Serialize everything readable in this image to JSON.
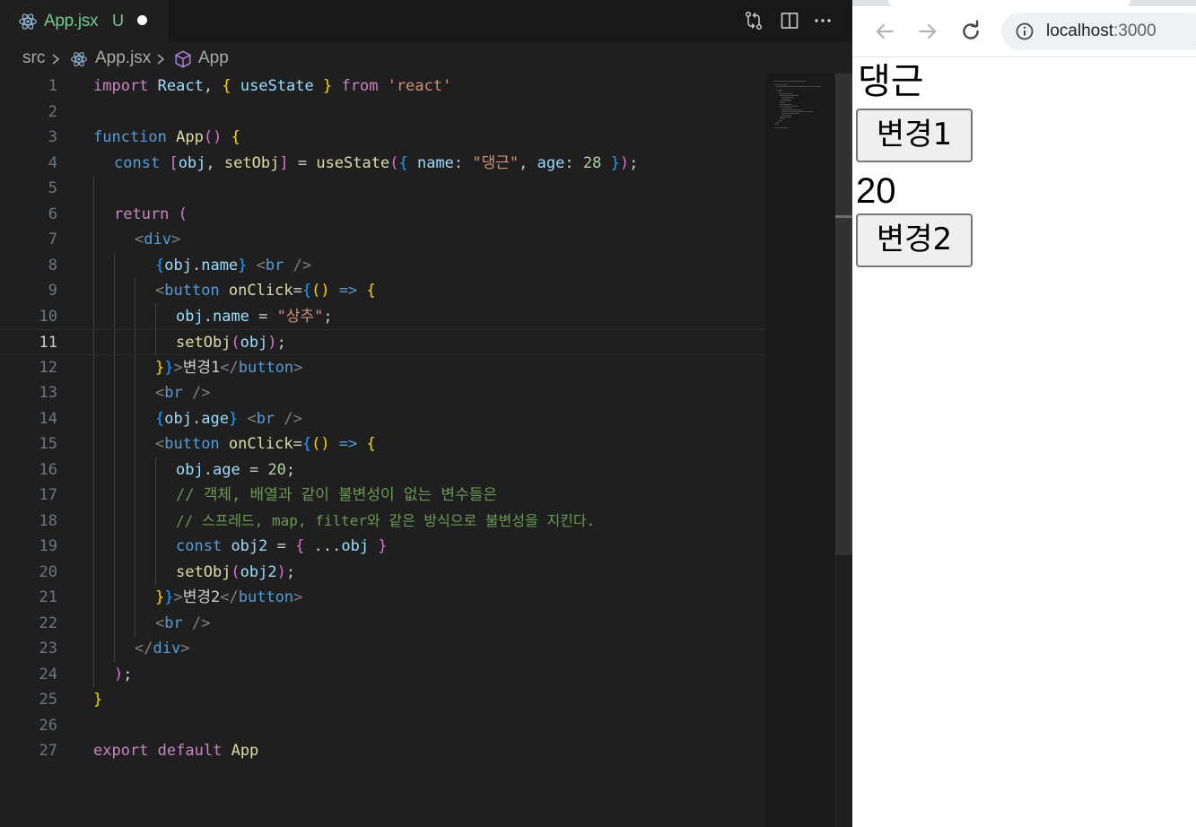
{
  "editor": {
    "tab": {
      "filename": "App.jsx",
      "status": "U"
    },
    "toolbar": {
      "icons": [
        "source-control-compare-icon",
        "split-editor-icon",
        "more-actions-icon"
      ]
    },
    "breadcrumb": {
      "folder": "src",
      "file": "App.jsx",
      "symbol": "App"
    },
    "active_line": 11,
    "line_numbers": [
      "1",
      "2",
      "3",
      "4",
      "5",
      "6",
      "7",
      "8",
      "9",
      "10",
      "11",
      "12",
      "13",
      "14",
      "15",
      "16",
      "17",
      "18",
      "19",
      "20",
      "21",
      "22",
      "23",
      "24",
      "25",
      "26",
      "27"
    ],
    "code": {
      "l1": {
        "import": "import",
        "react": "React",
        "comma": ",",
        "lb": "{",
        "useState": "useState",
        "rb": "}",
        "from": "from",
        "mod": "'react'"
      },
      "l3": {
        "function": "function",
        "name": "App",
        "parens": "()",
        "lb": "{"
      },
      "l4": {
        "const": "const",
        "lb": "[",
        "obj": "obj",
        "comma": ",",
        "setObj": "setObj",
        "rb": "]",
        "eq": "=",
        "useState": "useState",
        "lp": "(",
        "lc": "{",
        "key1": "name",
        "colon1": ":",
        "val1": "\"댕근\"",
        "comma2": ",",
        "key2": "age",
        "colon2": ":",
        "val2": "28",
        "rc": "}",
        "rp": ")",
        "semi": ";"
      },
      "l6": {
        "return": "return",
        "lp": "("
      },
      "l7": {
        "open": "<",
        "tag": "div",
        "close": ">"
      },
      "l8": {
        "lb": "{",
        "obj": "obj",
        "dot": ".",
        "prop": "name",
        "rb": "}",
        "open": "<",
        "tag": "br",
        "close": "/>"
      },
      "l9": {
        "open": "<",
        "tag": "button",
        "attr": "onClick",
        "eq": "=",
        "lb": "{",
        "parens": "()",
        "arrow": "=>",
        "lc": "{"
      },
      "l10": {
        "obj": "obj",
        "dot": ".",
        "prop": "name",
        "eq": "=",
        "val": "\"상추\"",
        "semi": ";"
      },
      "l11": {
        "fn": "setObj",
        "lp": "(",
        "arg": "obj",
        "rp": ")",
        "semi": ";"
      },
      "l12": {
        "rc": "}",
        "rb": "}",
        "gt": ">",
        "text": "변경1",
        "open": "</",
        "tag": "button",
        "close": ">"
      },
      "l13": {
        "open": "<",
        "tag": "br",
        "close": "/>"
      },
      "l14": {
        "lb": "{",
        "obj": "obj",
        "dot": ".",
        "prop": "age",
        "rb": "}",
        "open": "<",
        "tag": "br",
        "close": "/>"
      },
      "l15": {
        "open": "<",
        "tag": "button",
        "attr": "onClick",
        "eq": "=",
        "lb": "{",
        "parens": "()",
        "arrow": "=>",
        "lc": "{"
      },
      "l16": {
        "obj": "obj",
        "dot": ".",
        "prop": "age",
        "eq": "=",
        "val": "20",
        "semi": ";"
      },
      "l17": {
        "comment": "// 객체, 배열과 같이 불변성이 없는 변수들은"
      },
      "l18": {
        "comment": "// 스프레드, map, filter와 같은 방식으로 불변성을 지킨다."
      },
      "l19": {
        "const": "const",
        "name": "obj2",
        "eq": "=",
        "lb": "{",
        "spread": "...",
        "obj": "obj",
        "rb": "}"
      },
      "l20": {
        "fn": "setObj",
        "lp": "(",
        "arg": "obj2",
        "rp": ")",
        "semi": ";"
      },
      "l21": {
        "rc": "}",
        "rb": "}",
        "gt": ">",
        "text": "변경2",
        "open": "</",
        "tag": "button",
        "close": ">"
      },
      "l22": {
        "open": "<",
        "tag": "br",
        "close": "/>"
      },
      "l23": {
        "open": "</",
        "tag": "div",
        "close": ">"
      },
      "l24": {
        "rp": ")",
        "semi": ";"
      },
      "l25": {
        "rb": "}"
      },
      "l27": {
        "export": "export",
        "default": "default",
        "name": "App"
      }
    }
  },
  "browser": {
    "url_host": "localhost",
    "url_port": ":3000",
    "nav_icons": [
      "back-icon",
      "forward-icon",
      "reload-icon",
      "site-info-icon"
    ],
    "page": {
      "name_value": "댕근",
      "button1_label": "변경1",
      "age_value": "20",
      "button2_label": "변경2"
    }
  }
}
